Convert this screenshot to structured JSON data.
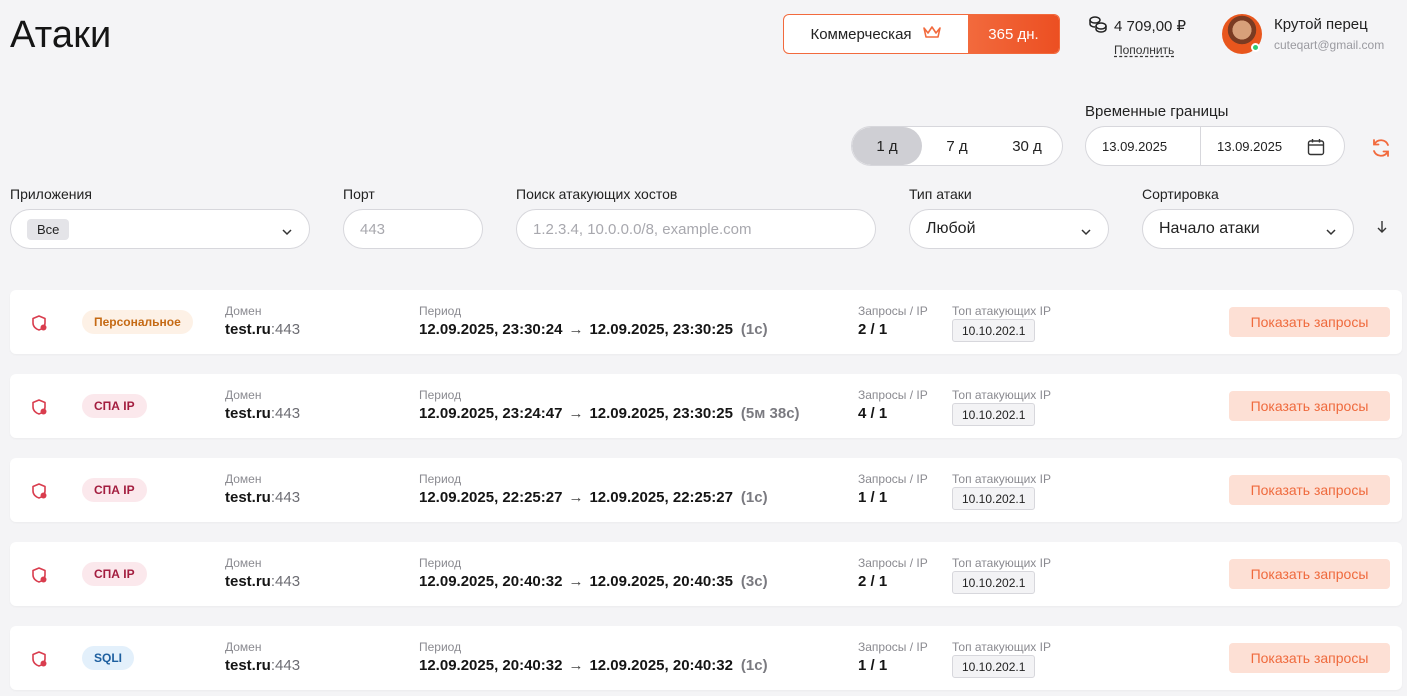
{
  "header": {
    "title": "Атаки",
    "plan_name": "Коммерческая",
    "plan_icon": "crown-icon",
    "plan_days": "365 дн.",
    "balance": "4 709,00 ₽",
    "balance_icon": "coins-icon",
    "topup_label": "Пополнить",
    "user_name": "Крутой перец",
    "user_email": "cuteqart@gmail.com"
  },
  "filters": {
    "range_options": [
      "1 д",
      "7 д",
      "30 д"
    ],
    "range_active": "1 д",
    "time_bounds_label": "Временные границы",
    "date_from": "13.09.2025",
    "date_to": "13.09.2025",
    "apps_label": "Приложения",
    "apps_value": "Все",
    "port_label": "Порт",
    "port_placeholder": "443",
    "hosts_label": "Поиск атакующих хостов",
    "hosts_placeholder": "1.2.3.4, 10.0.0.0/8, example.com",
    "attack_type_label": "Тип атаки",
    "attack_type_value": "Любой",
    "sort_label": "Сортировка",
    "sort_value": "Начало атаки"
  },
  "labels": {
    "domain": "Домен",
    "period": "Период",
    "requests_ip": "Запросы / IP",
    "top_ips": "Топ атакующих IP",
    "show_requests": "Показать запросы",
    "arrow": "→"
  },
  "colors": {
    "accent": "#f26a3d",
    "online": "#2ecc71"
  },
  "attacks": [
    {
      "tag": "Персональное",
      "tag_kind": "personal",
      "domain": "test.ru",
      "port": ":443",
      "start": "12.09.2025, 23:30:24",
      "end": "12.09.2025, 23:30:25",
      "duration": "(1с)",
      "requests_ip": "2 / 1",
      "top_ip": "10.10.202.1"
    },
    {
      "tag": "СПА IP",
      "tag_kind": "spa",
      "domain": "test.ru",
      "port": ":443",
      "start": "12.09.2025, 23:24:47",
      "end": "12.09.2025, 23:30:25",
      "duration": "(5м 38с)",
      "requests_ip": "4 / 1",
      "top_ip": "10.10.202.1"
    },
    {
      "tag": "СПА IP",
      "tag_kind": "spa",
      "domain": "test.ru",
      "port": ":443",
      "start": "12.09.2025, 22:25:27",
      "end": "12.09.2025, 22:25:27",
      "duration": "(1с)",
      "requests_ip": "1 / 1",
      "top_ip": "10.10.202.1"
    },
    {
      "tag": "СПА IP",
      "tag_kind": "spa",
      "domain": "test.ru",
      "port": ":443",
      "start": "12.09.2025, 20:40:32",
      "end": "12.09.2025, 20:40:35",
      "duration": "(3с)",
      "requests_ip": "2 / 1",
      "top_ip": "10.10.202.1"
    },
    {
      "tag": "SQLI",
      "tag_kind": "sqli",
      "domain": "test.ru",
      "port": ":443",
      "start": "12.09.2025, 20:40:32",
      "end": "12.09.2025, 20:40:32",
      "duration": "(1с)",
      "requests_ip": "1 / 1",
      "top_ip": "10.10.202.1"
    }
  ]
}
